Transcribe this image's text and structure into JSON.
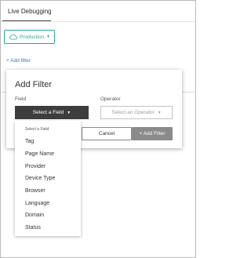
{
  "header": {
    "title": "Live Debugging"
  },
  "environment": {
    "label": "Production",
    "icon": "cloud-icon"
  },
  "add_filter_link": "+ Add filter",
  "modal": {
    "title": "Add Filter",
    "field_label": "Field",
    "operator_label": "Operator",
    "field_select_value": "Select a Field",
    "operator_select_value": "Select an Operator",
    "cancel_label": "Cancel",
    "add_label": "+ Add Filter"
  },
  "dropdown": {
    "header": "Select a Field",
    "items": [
      "Tag",
      "Page Name",
      "Provider",
      "Device Type",
      "Browser",
      "Language",
      "Domain",
      "Status"
    ]
  },
  "colors": {
    "accent_green": "#2aa895",
    "link_blue": "#2f80c8",
    "dark_select": "#3d3d3d",
    "disabled_button": "#8a8a8a"
  }
}
